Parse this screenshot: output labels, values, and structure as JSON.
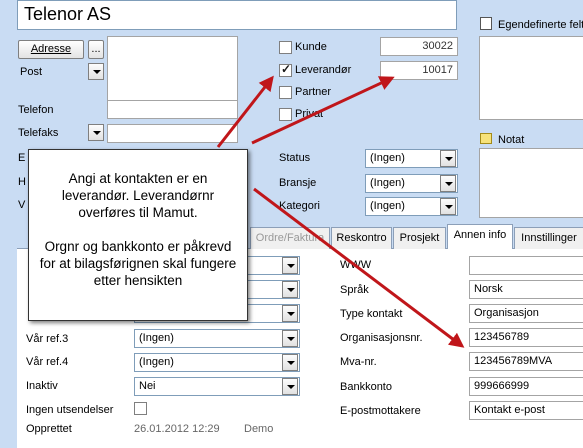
{
  "header": {
    "title": "Telenor AS"
  },
  "address": {
    "address_button": "Adresse",
    "more_button": "...",
    "post_label": "Post"
  },
  "contact_fields": {
    "telefon_label": "Telefon",
    "telefaks_label": "Telefaks",
    "e_label": "E",
    "h_label": "H",
    "v_label": "V"
  },
  "roles": {
    "kunde": {
      "label": "Kunde",
      "checked": false,
      "number": "30022"
    },
    "leverandor": {
      "label": "Leverandør",
      "checked": true,
      "number": "10017"
    },
    "partner": {
      "label": "Partner",
      "checked": false
    },
    "privat": {
      "label": "Privat",
      "checked": false
    }
  },
  "classification": {
    "status": {
      "label": "Status",
      "value": "(Ingen)"
    },
    "bransje": {
      "label": "Bransje",
      "value": "(Ingen)"
    },
    "kategori": {
      "label": "Kategori",
      "value": "(Ingen)"
    }
  },
  "side_panels": {
    "custom_fields_label": "Egendefinerte felt",
    "note_label": "Notat"
  },
  "tabs": [
    {
      "label": "Ordre/Faktura"
    },
    {
      "label": "Reskontro"
    },
    {
      "label": "Prosjekt"
    },
    {
      "label": "Annen info"
    },
    {
      "label": "Innstillinger"
    }
  ],
  "left_form": {
    "var_ref3": {
      "label": "Vår ref.3",
      "value": "(Ingen)"
    },
    "var_ref4": {
      "label": "Vår ref.4",
      "value": "(Ingen)"
    },
    "inaktiv": {
      "label": "Inaktiv",
      "value": "Nei"
    },
    "ingen_utsendelser": {
      "label": "Ingen utsendelser",
      "checked": false
    },
    "opprettet": {
      "label": "Opprettet",
      "date": "26.01.2012 12:29",
      "user": "Demo"
    }
  },
  "annen_info": {
    "www": {
      "label": "WWW",
      "value": ""
    },
    "sprak": {
      "label": "Språk",
      "value": "Norsk"
    },
    "type_kontakt": {
      "label": "Type kontakt",
      "value": "Organisasjon"
    },
    "orgnr": {
      "label": "Organisasjonsnr.",
      "value": "123456789"
    },
    "mva": {
      "label": "Mva-nr.",
      "value": "123456789MVA"
    },
    "bankkonto": {
      "label": "Bankkonto",
      "value": "999666999"
    },
    "epost": {
      "label": "E-postmottakere",
      "value": "Kontakt e-post"
    }
  },
  "callout": {
    "paragraph1": "Angi at kontakten er en leverandør. Leverandørnr overføres til Mamut.",
    "paragraph2": "Orgnr og bankkonto er påkrevd for at bilagsførignen skal fungere etter hensikten"
  },
  "colors": {
    "background": "#c9dcf3",
    "arrow": "#c0161a"
  }
}
